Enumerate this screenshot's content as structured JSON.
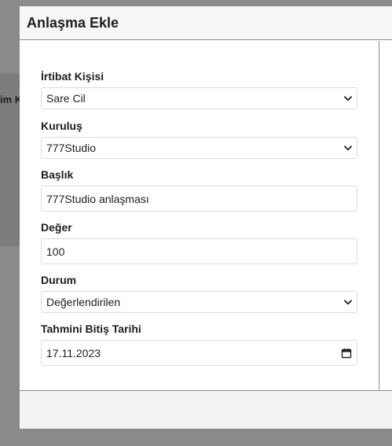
{
  "background": {
    "partial_text": "im K"
  },
  "modal": {
    "title": "Anlaşma Ekle",
    "fields": [
      {
        "label": "İrtibat Kişisi",
        "value": "Sare Cil",
        "type": "select"
      },
      {
        "label": "Kuruluş",
        "value": "777Studio",
        "type": "select"
      },
      {
        "label": "Başlık",
        "value": "777Studio anlaşması",
        "type": "text"
      },
      {
        "label": "Değer",
        "value": "100",
        "type": "number"
      },
      {
        "label": "Durum",
        "value": "Değerlendirilen",
        "type": "select"
      },
      {
        "label": "Tahmini Bitiş Tarihi",
        "value": "17.11.2023",
        "type": "date"
      }
    ]
  },
  "icons": {
    "select_arrow": "chevron-down-icon",
    "date_picker": "calendar-icon"
  }
}
